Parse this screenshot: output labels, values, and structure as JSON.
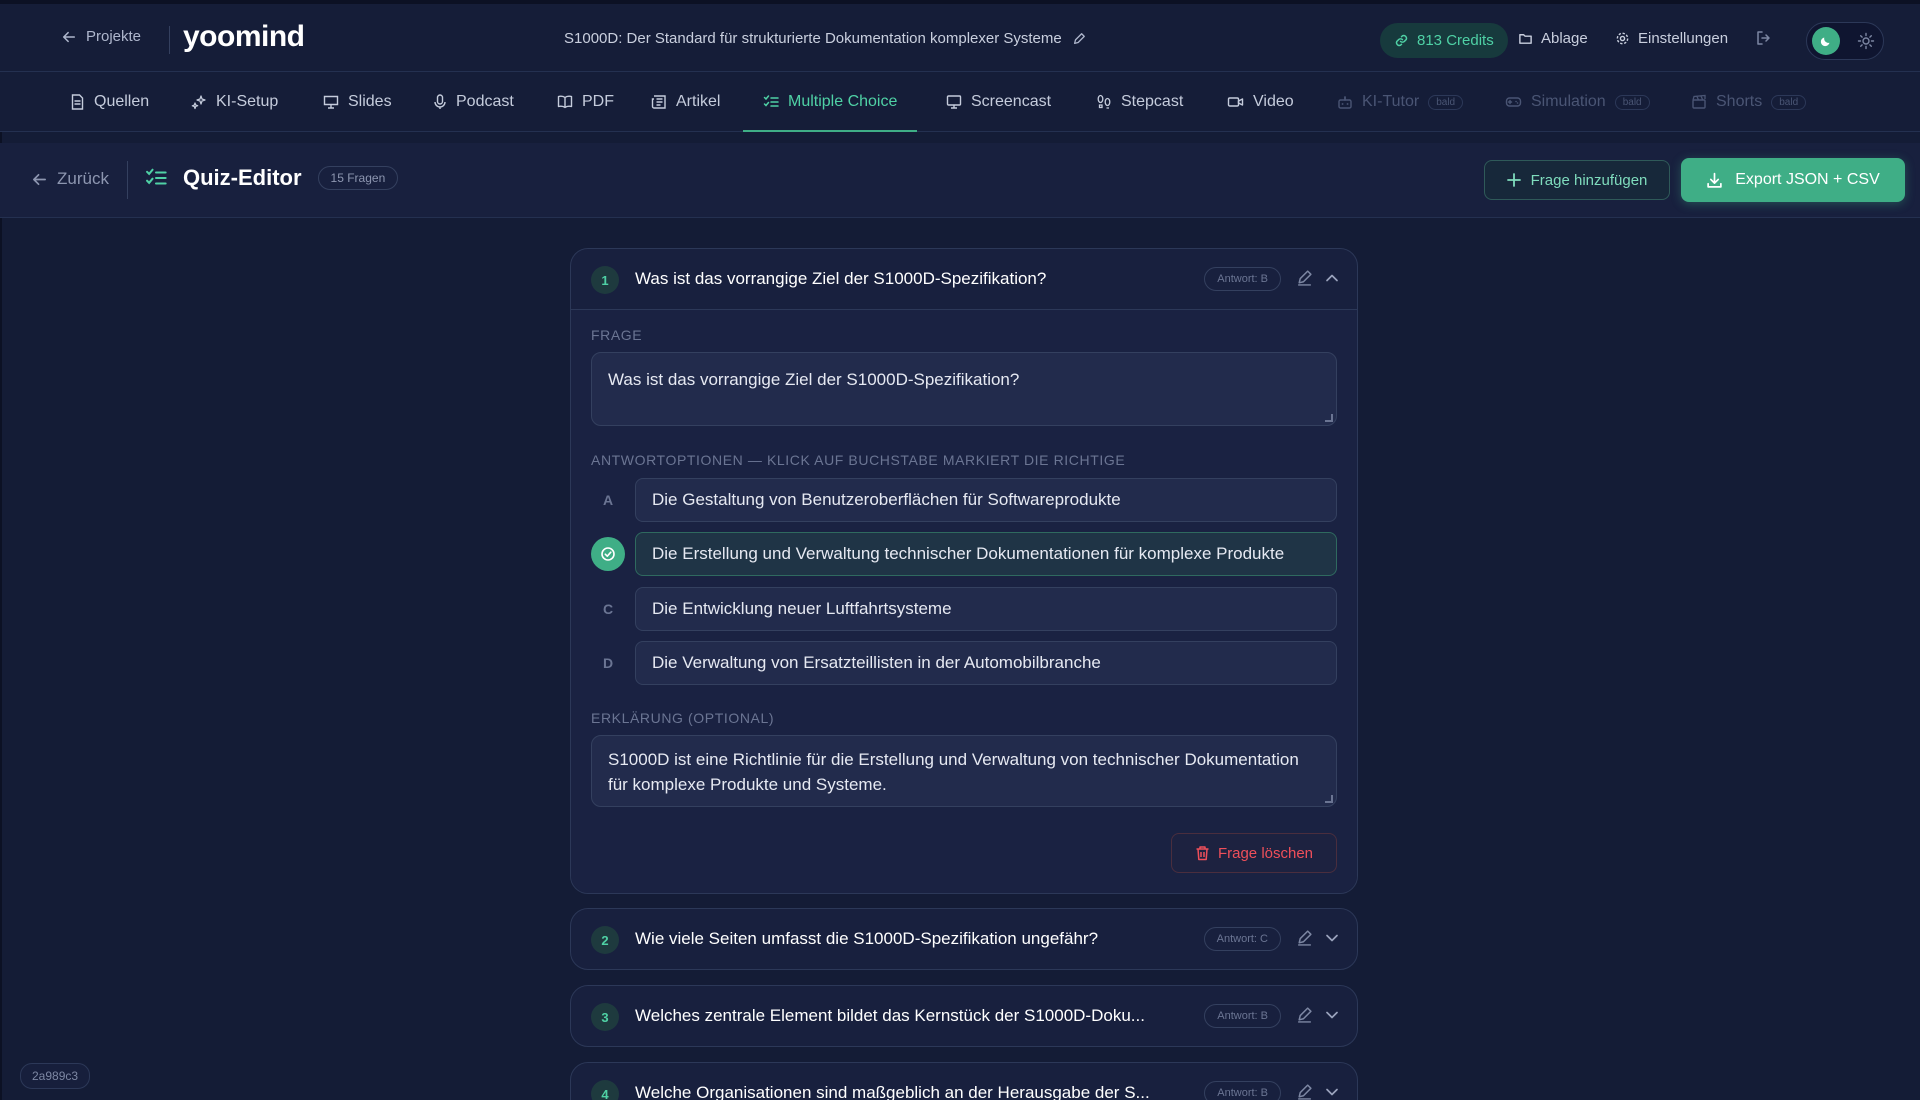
{
  "topbar": {
    "back_label": "Projekte",
    "logo": "yoomind",
    "project_title": "S1000D: Der Standard für strukturierte Dokumentation komplexer Systeme",
    "credits": "813 Credits",
    "ablage": "Ablage",
    "settings": "Einstellungen"
  },
  "tabs": [
    {
      "label": "Quellen",
      "icon": "document-icon"
    },
    {
      "label": "KI-Setup",
      "icon": "sparkles-icon"
    },
    {
      "label": "Slides",
      "icon": "presentation-icon"
    },
    {
      "label": "Podcast",
      "icon": "microphone-icon"
    },
    {
      "label": "PDF",
      "icon": "book-icon"
    },
    {
      "label": "Artikel",
      "icon": "newspaper-icon"
    },
    {
      "label": "Multiple Choice",
      "icon": "checklist-icon",
      "active": true
    },
    {
      "label": "Screencast",
      "icon": "monitor-icon"
    },
    {
      "label": "Stepcast",
      "icon": "footsteps-icon"
    },
    {
      "label": "Video",
      "icon": "video-icon"
    },
    {
      "label": "KI-Tutor",
      "icon": "robot-icon",
      "soon": "bald"
    },
    {
      "label": "Simulation",
      "icon": "gamepad-icon",
      "soon": "bald"
    },
    {
      "label": "Shorts",
      "icon": "clapperboard-icon",
      "soon": "bald"
    }
  ],
  "editor": {
    "back_label": "Zurück",
    "title": "Quiz-Editor",
    "count": "15 Fragen",
    "add_button": "Frage hinzufügen",
    "export_button": "Export JSON + CSV"
  },
  "questions": [
    {
      "number": "1",
      "title": "Was ist das vorrangige Ziel der S1000D-Spezifikation?",
      "answer_badge": "Antwort: B",
      "expanded": true,
      "frage_label": "FRAGE",
      "frage_text": "Was ist das vorrangige Ziel der S1000D-Spezifikation?",
      "options_label": "ANTWORTOPTIONEN — KLICK AUF BUCHSTABE MARKIERT DIE RICHTIGE",
      "options": [
        {
          "letter": "A",
          "text": "Die Gestaltung von Benutzeroberflächen für Softwareprodukte"
        },
        {
          "letter": "B",
          "text": "Die Erstellung und Verwaltung technischer Dokumentationen für komplexe Produkte",
          "correct": true
        },
        {
          "letter": "C",
          "text": "Die Entwicklung neuer Luftfahrtsysteme"
        },
        {
          "letter": "D",
          "text": "Die Verwaltung von Ersatzteillisten in der Automobilbranche"
        }
      ],
      "explanation_label": "ERKLÄRUNG (OPTIONAL)",
      "explanation_text": "S1000D ist eine Richtlinie für die Erstellung und Verwaltung von technischer Dokumentation für komplexe Produkte und Systeme.",
      "delete_label": "Frage löschen"
    },
    {
      "number": "2",
      "title": "Wie viele Seiten umfasst die S1000D-Spezifikation ungefähr?",
      "answer_badge": "Antwort: C"
    },
    {
      "number": "3",
      "title": "Welches zentrale Element bildet das Kernstück der S1000D-Doku...",
      "answer_badge": "Antwort: B"
    },
    {
      "number": "4",
      "title": "Welche Organisationen sind maßgeblich an der Herausgabe der S...",
      "answer_badge": "Antwort: B"
    }
  ],
  "version": "2a989c3",
  "colors": {
    "background": "#141c36",
    "accent": "#3fae86",
    "accent_text": "#4fd1a5",
    "danger": "#ef4f5a"
  }
}
